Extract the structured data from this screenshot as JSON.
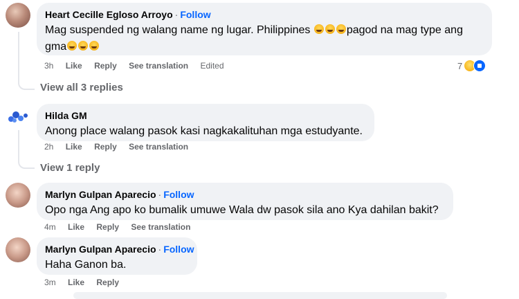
{
  "comments": [
    {
      "author": "Heart Cecille Egloso Arroyo",
      "separator": "·",
      "follow": "Follow",
      "text_before": "Mag suspended ng walang name ng lugar. Philippines ",
      "text_middle": "pagod na mag type ang",
      "text_line2": "gma",
      "time": "3h",
      "like": "Like",
      "reply": "Reply",
      "translate": "See translation",
      "edited": "Edited",
      "reaction_count": "7",
      "reaction_icons": [
        "haha-icon",
        "like-icon"
      ]
    },
    {
      "author": "Hilda GM",
      "text": "Anong place walang pasok kasi nagkakalituhan mga estudyante.",
      "time": "2h",
      "like": "Like",
      "reply": "Reply",
      "translate": "See translation"
    },
    {
      "author": "Marlyn Gulpan Aparecio",
      "separator": "·",
      "follow": "Follow",
      "text": "Opo nga Ang apo ko bumalik umuwe Wala dw pasok sila ano Kya dahilan bakit?",
      "time": "4m",
      "like": "Like",
      "reply": "Reply",
      "translate": "See translation"
    },
    {
      "author": "Marlyn Gulpan Aparecio",
      "separator": "·",
      "follow": "Follow",
      "text": "Haha Ganon ba.",
      "time": "3m",
      "like": "Like",
      "reply": "Reply"
    }
  ],
  "view_replies": [
    "View all 3 replies",
    "View 1 reply"
  ],
  "colors": {
    "bubble": "#f0f2f5",
    "follow": "#0866ff",
    "meta": "#65676b"
  }
}
